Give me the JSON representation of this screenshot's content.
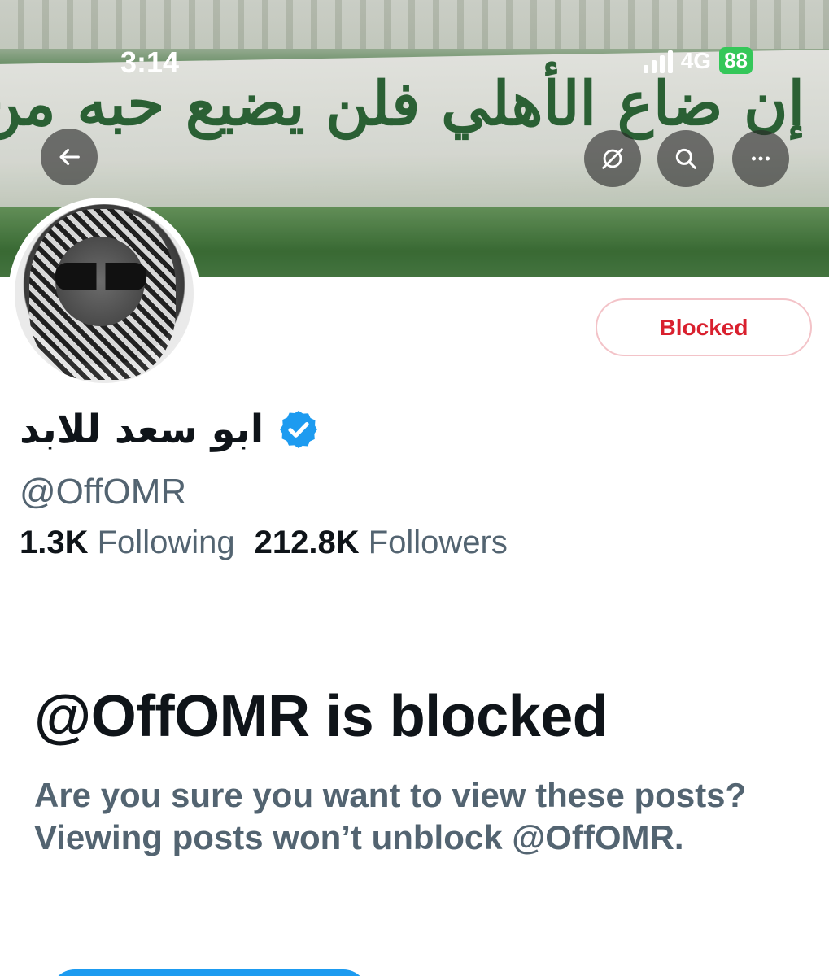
{
  "status_bar": {
    "time": "3:14",
    "network": "4G",
    "battery": "88"
  },
  "banner": {
    "text": "إن ضاع الأهلي فلن يضيع حبه من قلوبنا"
  },
  "header_buttons": {
    "back_icon": "arrow-left-icon",
    "translate_icon": "globe-slash-icon",
    "search_icon": "search-icon",
    "more_icon": "more-horizontal-icon"
  },
  "profile": {
    "display_name": "ابو سعد للابد",
    "handle": "@OffOMR",
    "verified": true,
    "following_count": "1.3K",
    "following_label": "Following",
    "followers_count": "212.8K",
    "followers_label": "Followers"
  },
  "actions": {
    "blocked_label": "Blocked"
  },
  "blocked_notice": {
    "title": "@OffOMR is blocked",
    "description": "Are you sure you want to view these posts? Viewing posts won’t unblock @OffOMR."
  },
  "colors": {
    "accent": "#1d9bf0",
    "blocked_red": "#d9202e",
    "secondary_text": "#536471",
    "primary_text": "#0f1419",
    "verified_blue": "#1d9bf0"
  }
}
